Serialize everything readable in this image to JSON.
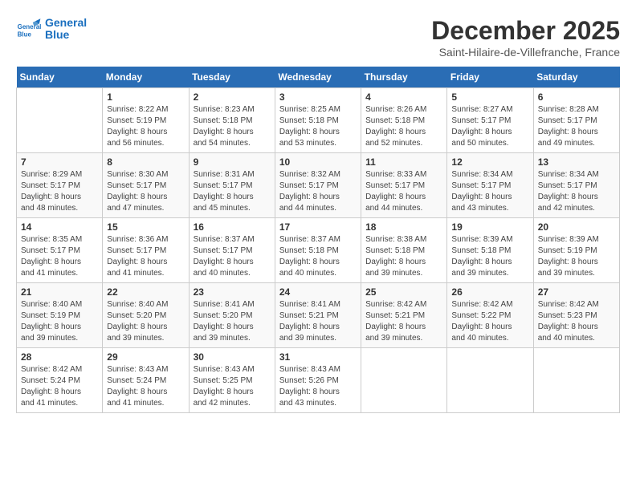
{
  "header": {
    "logo": {
      "line1": "General",
      "line2": "Blue"
    },
    "title": "December 2025",
    "location": "Saint-Hilaire-de-Villefranche, France"
  },
  "calendar": {
    "days_of_week": [
      "Sunday",
      "Monday",
      "Tuesday",
      "Wednesday",
      "Thursday",
      "Friday",
      "Saturday"
    ],
    "weeks": [
      [
        {
          "day": "",
          "info": ""
        },
        {
          "day": "1",
          "info": "Sunrise: 8:22 AM\nSunset: 5:19 PM\nDaylight: 8 hours\nand 56 minutes."
        },
        {
          "day": "2",
          "info": "Sunrise: 8:23 AM\nSunset: 5:18 PM\nDaylight: 8 hours\nand 54 minutes."
        },
        {
          "day": "3",
          "info": "Sunrise: 8:25 AM\nSunset: 5:18 PM\nDaylight: 8 hours\nand 53 minutes."
        },
        {
          "day": "4",
          "info": "Sunrise: 8:26 AM\nSunset: 5:18 PM\nDaylight: 8 hours\nand 52 minutes."
        },
        {
          "day": "5",
          "info": "Sunrise: 8:27 AM\nSunset: 5:17 PM\nDaylight: 8 hours\nand 50 minutes."
        },
        {
          "day": "6",
          "info": "Sunrise: 8:28 AM\nSunset: 5:17 PM\nDaylight: 8 hours\nand 49 minutes."
        }
      ],
      [
        {
          "day": "7",
          "info": "Sunrise: 8:29 AM\nSunset: 5:17 PM\nDaylight: 8 hours\nand 48 minutes."
        },
        {
          "day": "8",
          "info": "Sunrise: 8:30 AM\nSunset: 5:17 PM\nDaylight: 8 hours\nand 47 minutes."
        },
        {
          "day": "9",
          "info": "Sunrise: 8:31 AM\nSunset: 5:17 PM\nDaylight: 8 hours\nand 45 minutes."
        },
        {
          "day": "10",
          "info": "Sunrise: 8:32 AM\nSunset: 5:17 PM\nDaylight: 8 hours\nand 44 minutes."
        },
        {
          "day": "11",
          "info": "Sunrise: 8:33 AM\nSunset: 5:17 PM\nDaylight: 8 hours\nand 44 minutes."
        },
        {
          "day": "12",
          "info": "Sunrise: 8:34 AM\nSunset: 5:17 PM\nDaylight: 8 hours\nand 43 minutes."
        },
        {
          "day": "13",
          "info": "Sunrise: 8:34 AM\nSunset: 5:17 PM\nDaylight: 8 hours\nand 42 minutes."
        }
      ],
      [
        {
          "day": "14",
          "info": "Sunrise: 8:35 AM\nSunset: 5:17 PM\nDaylight: 8 hours\nand 41 minutes."
        },
        {
          "day": "15",
          "info": "Sunrise: 8:36 AM\nSunset: 5:17 PM\nDaylight: 8 hours\nand 41 minutes."
        },
        {
          "day": "16",
          "info": "Sunrise: 8:37 AM\nSunset: 5:17 PM\nDaylight: 8 hours\nand 40 minutes."
        },
        {
          "day": "17",
          "info": "Sunrise: 8:37 AM\nSunset: 5:18 PM\nDaylight: 8 hours\nand 40 minutes."
        },
        {
          "day": "18",
          "info": "Sunrise: 8:38 AM\nSunset: 5:18 PM\nDaylight: 8 hours\nand 39 minutes."
        },
        {
          "day": "19",
          "info": "Sunrise: 8:39 AM\nSunset: 5:18 PM\nDaylight: 8 hours\nand 39 minutes."
        },
        {
          "day": "20",
          "info": "Sunrise: 8:39 AM\nSunset: 5:19 PM\nDaylight: 8 hours\nand 39 minutes."
        }
      ],
      [
        {
          "day": "21",
          "info": "Sunrise: 8:40 AM\nSunset: 5:19 PM\nDaylight: 8 hours\nand 39 minutes."
        },
        {
          "day": "22",
          "info": "Sunrise: 8:40 AM\nSunset: 5:20 PM\nDaylight: 8 hours\nand 39 minutes."
        },
        {
          "day": "23",
          "info": "Sunrise: 8:41 AM\nSunset: 5:20 PM\nDaylight: 8 hours\nand 39 minutes."
        },
        {
          "day": "24",
          "info": "Sunrise: 8:41 AM\nSunset: 5:21 PM\nDaylight: 8 hours\nand 39 minutes."
        },
        {
          "day": "25",
          "info": "Sunrise: 8:42 AM\nSunset: 5:21 PM\nDaylight: 8 hours\nand 39 minutes."
        },
        {
          "day": "26",
          "info": "Sunrise: 8:42 AM\nSunset: 5:22 PM\nDaylight: 8 hours\nand 40 minutes."
        },
        {
          "day": "27",
          "info": "Sunrise: 8:42 AM\nSunset: 5:23 PM\nDaylight: 8 hours\nand 40 minutes."
        }
      ],
      [
        {
          "day": "28",
          "info": "Sunrise: 8:42 AM\nSunset: 5:24 PM\nDaylight: 8 hours\nand 41 minutes."
        },
        {
          "day": "29",
          "info": "Sunrise: 8:43 AM\nSunset: 5:24 PM\nDaylight: 8 hours\nand 41 minutes."
        },
        {
          "day": "30",
          "info": "Sunrise: 8:43 AM\nSunset: 5:25 PM\nDaylight: 8 hours\nand 42 minutes."
        },
        {
          "day": "31",
          "info": "Sunrise: 8:43 AM\nSunset: 5:26 PM\nDaylight: 8 hours\nand 43 minutes."
        },
        {
          "day": "",
          "info": ""
        },
        {
          "day": "",
          "info": ""
        },
        {
          "day": "",
          "info": ""
        }
      ]
    ]
  }
}
